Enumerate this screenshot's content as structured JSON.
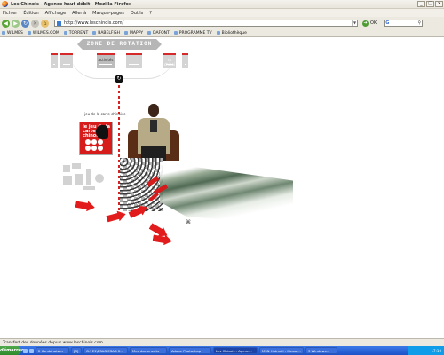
{
  "window": {
    "title": "Les Chinois - Agence haut débit - Mozilla Firefox",
    "controls": [
      "_",
      "□",
      "x"
    ]
  },
  "menu": [
    "Fichier",
    "Édition",
    "Affichage",
    "Aller à",
    "Marque-pages",
    "Outils",
    "?"
  ],
  "toolbar": {
    "url": "http://www.leschinois.com/",
    "go_label": "OK",
    "search_engine": "G"
  },
  "bookmarks": [
    "WILMES",
    "WILMES.COM",
    "TORRENT",
    "BABELFISH",
    "MAPPY",
    "DAFONT",
    "PROGRAMME TV",
    "Bibliothèque"
  ],
  "page": {
    "zone_title": "ZONE DE ROTATION",
    "tab_active": "activités",
    "tab_label_5": "la chinoi",
    "card_caption": "jeu de la carte chinoise",
    "card_text": "le jeu de la carte chinoise"
  },
  "status": "Transfert des données depuis www.leschinois.com...",
  "taskbar": {
    "start": "démarrer",
    "tasks": [
      {
        "label": "2 Kombinaison"
      },
      {
        "label": "[S]"
      },
      {
        "label": "G:\\ E1\\ESAG ESAD 2..."
      },
      {
        "label": "Mes documents"
      },
      {
        "label": "Adobe Photoshop"
      },
      {
        "label": "Les Chinois - Agenc...",
        "active": true
      },
      {
        "label": "MSN Hotmail - Messa..."
      },
      {
        "label": "3 Windows..."
      }
    ],
    "clock": "17:10"
  }
}
